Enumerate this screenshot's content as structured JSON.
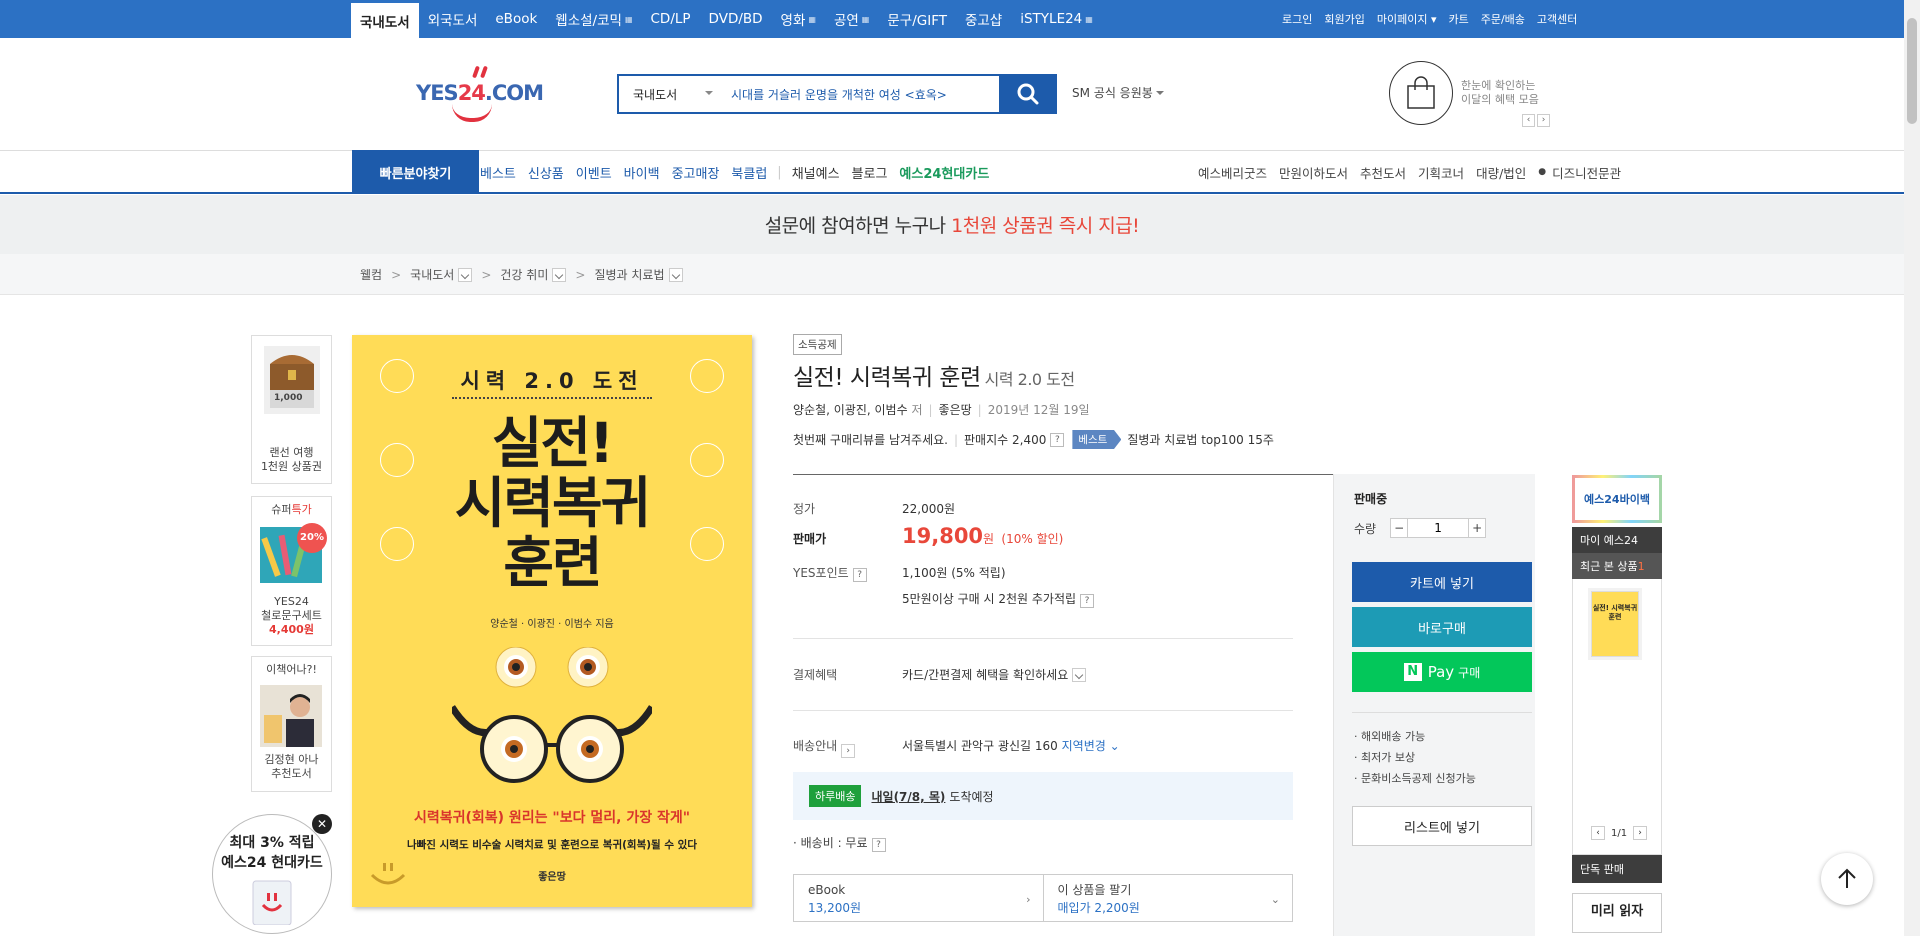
{
  "topnav": {
    "categories": [
      {
        "label": "국내도서",
        "active": true,
        "more": false
      },
      {
        "label": "외국도서",
        "active": false,
        "more": false
      },
      {
        "label": "eBook",
        "active": false,
        "more": false
      },
      {
        "label": "웹소설/코믹",
        "active": false,
        "more": true
      },
      {
        "label": "CD/LP",
        "active": false,
        "more": false
      },
      {
        "label": "DVD/BD",
        "active": false,
        "more": false
      },
      {
        "label": "영화",
        "active": false,
        "more": true
      },
      {
        "label": "공연",
        "active": false,
        "more": true
      },
      {
        "label": "문구/GIFT",
        "active": false,
        "more": false
      },
      {
        "label": "중고샵",
        "active": false,
        "more": false
      },
      {
        "label": "iSTYLE24",
        "active": false,
        "more": true
      }
    ],
    "util": [
      "로그인",
      "회원가입",
      "마이페이지 ▾",
      "카트",
      "주문/배송",
      "고객센터"
    ]
  },
  "header": {
    "logo_a": "YES",
    "logo_b": "24",
    "logo_c": ".COM",
    "search_scope": "국내도서",
    "search_keyword": "시대를 거슬러 운명을 개척한 여성 <효옥>",
    "fan": "SM 공식 응원봉",
    "benefit_l1": "한눈에 확인하는",
    "benefit_l2": "이달의 혜택 모음"
  },
  "catbar": {
    "quick": "빠른분야찾기",
    "links": [
      {
        "label": "베스트",
        "style": "blue"
      },
      {
        "label": "신상품",
        "style": "blue"
      },
      {
        "label": "이벤트",
        "style": "blue"
      },
      {
        "label": "바이백",
        "style": "blue"
      },
      {
        "label": "중고매장",
        "style": "blue"
      },
      {
        "label": "북클럽",
        "style": "blue"
      },
      {
        "label": "채널예스",
        "style": "plain"
      },
      {
        "label": "블로그",
        "style": "plain"
      },
      {
        "label": "예스24현대카드",
        "style": "green"
      }
    ],
    "right": [
      "예스베리굿즈",
      "만원이하도서",
      "추천도서",
      "기획코너",
      "대량/법인",
      "디즈니전문관"
    ]
  },
  "banner": {
    "pre": "설문에 참여하면 누구나 ",
    "highlight": "1천원 상품권 즉시 지급!"
  },
  "breadcrumb": [
    "웰컴",
    "국내도서",
    "건강 취미",
    "질병과 치료법"
  ],
  "left_ads": {
    "ad1_price": "1,000",
    "ad1_l1": "랜선 여행",
    "ad1_l2": "1천원 상품권",
    "ad2_title_a": "슈퍼",
    "ad2_title_b": "특가",
    "ad2_badge": "20%",
    "ad2_l1": "YES24",
    "ad2_l2": "철로문구세트",
    "ad2_price": "4,400원",
    "ad3_title": "이책어나?!",
    "ad3_l1": "김정현 아나",
    "ad3_l2": "추천도서",
    "card_l1": "최대 3% 적립",
    "card_l2": "예스24 현대카드"
  },
  "cover": {
    "subtitle": "시력 2.0 도전",
    "title_l1": "실전!",
    "title_l2": "시력복귀",
    "title_l3": "훈련",
    "authors": "양순철 · 이광진 · 이범수 지음",
    "slogan": "시력복귀(회복) 원리는 \"보다 멀리, 가장 작게\"",
    "slogan2": "나빠진 시력도 비수술 시력치료 및 훈련으로 복귀(회복)될 수 있다",
    "publisher": "좋은땅"
  },
  "product": {
    "tag": "소득공제",
    "title": "실전! 시력복귀 훈련",
    "subtitle": "시력 2.0 도전",
    "authors": "양순철, 이광진, 이범수",
    "author_suffix": "저",
    "publisher": "좋은땅",
    "date": "2019년 12월 19일",
    "review_prompt": "첫번째 구매리뷰를 남겨주세요.",
    "sales_index": "판매지수 2,400",
    "best_label": "베스트",
    "best_rank": "질병과 치료법 top100 15주",
    "price_label": "정가",
    "price": "22,000원",
    "sale_label": "판매가",
    "sale_price": "19,800",
    "sale_unit": "원",
    "discount": "(10% 할인)",
    "point_label": "YES포인트",
    "point": "1,100원 (5% 적립)",
    "point_extra": "5만원이상 구매 시 2천원 추가적립",
    "pay_label": "결제혜택",
    "pay_value": "카드/간편결제 혜택을 확인하세요",
    "ship_label": "배송안내",
    "ship_addr": "서울특별시 관악구 광신길 160",
    "ship_change": "지역변경",
    "day_badge": "하루배송",
    "day_date": "내일(7/8, 목)",
    "day_suffix": "도착예정",
    "ship_fee": "· 배송비 : 무료",
    "ebook_label": "eBook",
    "ebook_price": "13,200원",
    "sell_label": "이 상품을 팔기",
    "sell_price": "매입가 2,200원"
  },
  "buy": {
    "status": "판매중",
    "qty_label": "수량",
    "qty": "1",
    "cart": "카트에 넣기",
    "now": "바로구매",
    "npay_n": "N",
    "npay": "Pay",
    "npay_suffix": "구매",
    "features": [
      "· 해외배송 가능",
      "· 최저가 보상",
      "· 문화비소득공제 신청가능"
    ],
    "wishlist": "리스트에 넣기"
  },
  "rail": {
    "buyback": "예스24바이백",
    "my": "마이 예스24",
    "recent": "최근 본 상품",
    "recent_count": "1",
    "mini_title": "실전! 시력복귀 훈련",
    "page": "1/1",
    "solo": "단독 판매",
    "preview": "미리 읽자"
  },
  "colors": {
    "brand": "#2c71c4",
    "navy": "#1d5bab",
    "sale": "#e8473a",
    "npay": "#03c75a",
    "cover": "#ffdc57"
  }
}
